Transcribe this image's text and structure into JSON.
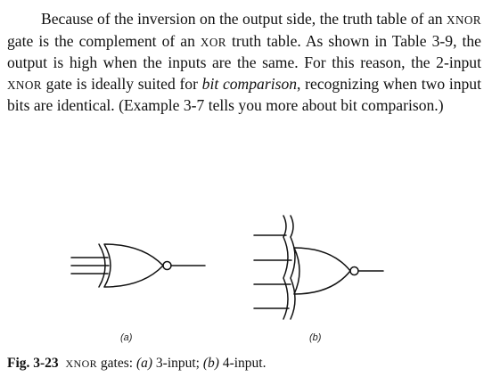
{
  "paragraph": {
    "s1": "Because of the inversion on the output side, the truth table of an ",
    "xnor1": "XNOR",
    "s2": " gate is the complement of an ",
    "xor1": "XOR",
    "s3": " truth table. As shown in Table 3-9, the output is high when the inputs are the same. For this reason, the 2-input ",
    "xnor2": "XNOR",
    "s4": " gate is ideally suited for ",
    "em": "bit comparison",
    "s5": ", recognizing when two input bits are identical. (Example 3-7 tells you more about bit comparison.)"
  },
  "figure": {
    "label_a": "(a)",
    "label_b": "(b)"
  },
  "caption": {
    "number": "Fig. 3-23",
    "xnor": "XNOR",
    "t1": " gates: ",
    "a": "(a)",
    "t2": " 3-input; ",
    "b": "(b)",
    "t3": " 4-input."
  }
}
